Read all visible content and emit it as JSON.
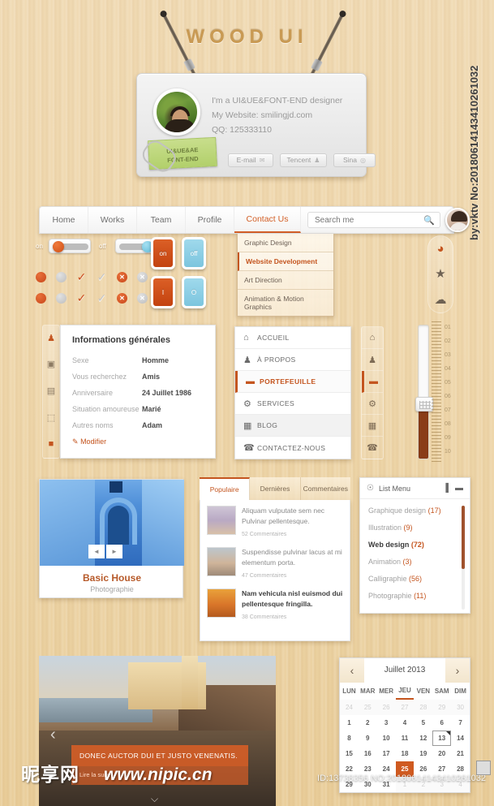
{
  "sign": {
    "title": "WOOD UI"
  },
  "profile": {
    "line1": "I'm a UI&UE&FONT-END designer",
    "line2": "My Website: smilingjd.com",
    "line3": "QQ: 125333110",
    "tag_line1": "UI&UE&AE",
    "tag_line2": "FONT-END",
    "buttons": [
      {
        "label": "E-mail",
        "icon": "envelope-icon",
        "glyph": "✉"
      },
      {
        "label": "Tencent",
        "icon": "penguin-icon",
        "glyph": "♟"
      },
      {
        "label": "Sina",
        "icon": "weibo-icon",
        "glyph": "◎"
      }
    ]
  },
  "nav": {
    "items": [
      {
        "label": "Home",
        "active": false
      },
      {
        "label": "Works",
        "active": false
      },
      {
        "label": "Team",
        "active": false
      },
      {
        "label": "Profile",
        "active": false
      },
      {
        "label": "Contact Us",
        "active": true
      }
    ],
    "search": {
      "placeholder": "Search me",
      "value": "",
      "icon": "search-icon"
    }
  },
  "dropdown": {
    "items": [
      {
        "label": "Graphic Design",
        "active": false
      },
      {
        "label": "Website Development",
        "active": true
      },
      {
        "label": "Art Direction",
        "active": false
      },
      {
        "label": "Animation & Motion Graphics",
        "active": false
      }
    ]
  },
  "toggles": {
    "on_label": "on",
    "off_label": "off",
    "sq_on": "on",
    "sq_off": "off",
    "sq_i": "I",
    "sq_o": "O"
  },
  "social_rail": {
    "items": [
      {
        "name": "chat-bubble-icon",
        "glyph": "◕",
        "color": "#c4551f"
      },
      {
        "name": "star-icon",
        "glyph": "★",
        "color": "#6f6253"
      },
      {
        "name": "cloud-icon",
        "glyph": "☁",
        "color": "#6f6253"
      }
    ]
  },
  "side_rail": {
    "items": [
      {
        "name": "users-icon",
        "glyph": "♟",
        "active": true
      },
      {
        "name": "image-icon",
        "glyph": "▣",
        "active": false
      },
      {
        "name": "save-icon",
        "glyph": "▤",
        "active": false
      },
      {
        "name": "file-icon",
        "glyph": "⬚",
        "active": false
      },
      {
        "name": "inbox-icon",
        "glyph": "■",
        "active": false
      }
    ]
  },
  "info_panel": {
    "title": "Informations générales",
    "rows": [
      {
        "key": "Sexe",
        "value": "Homme"
      },
      {
        "key": "Vous recherchez",
        "value": "Amis"
      },
      {
        "key": "Anniversaire",
        "value": "24 Juillet 1986"
      },
      {
        "key": "Situation amoureuse",
        "value": "Marié"
      },
      {
        "key": "Autres noms",
        "value": "Adam"
      }
    ],
    "edit_label": "Modifier",
    "edit_icon": "pencil-icon"
  },
  "menu_panel": {
    "items": [
      {
        "label": "ACCUEIL",
        "icon": "home-icon",
        "glyph": "⌂",
        "active": false
      },
      {
        "label": "À PROPOS",
        "icon": "user-group-icon",
        "glyph": "♟",
        "active": false
      },
      {
        "label": "PORTEFEUILLE",
        "icon": "briefcase-icon",
        "glyph": "▬",
        "active": true
      },
      {
        "label": "SERVICES",
        "icon": "gear-icon",
        "glyph": "⚙",
        "active": false
      },
      {
        "label": "BLOG",
        "icon": "grid-icon",
        "glyph": "▦",
        "active": false
      },
      {
        "label": "CONTACTEZ-NOUS",
        "icon": "phone-icon",
        "glyph": "☎",
        "active": false
      }
    ]
  },
  "ruler": {
    "ticks": [
      "01",
      "02",
      "03",
      "04",
      "05",
      "06",
      "07",
      "08",
      "09",
      "10"
    ]
  },
  "photo_card": {
    "title": "Basic House",
    "subtitle": "Photographie",
    "prev_icon": "chevron-left-icon",
    "next_icon": "chevron-right-icon",
    "prev_glyph": "◄",
    "next_glyph": "►"
  },
  "tabs_panel": {
    "tabs": [
      {
        "label": "Populaire",
        "active": true
      },
      {
        "label": "Dernières",
        "active": false
      },
      {
        "label": "Commentaires",
        "active": false
      }
    ],
    "posts": [
      {
        "title": "Aliquam vulputate sem nec Pulvinar pellentesque.",
        "meta": "52 Commentaires",
        "bold": false
      },
      {
        "title": "Suspendisse pulvinar lacus at mi elementum porta.",
        "meta": "47 Commentaires",
        "bold": false
      },
      {
        "title": "Nam vehicula nisl euismod dui pellentesque fringilla.",
        "meta": "38 Commentaires",
        "bold": true
      }
    ]
  },
  "list_menu": {
    "title": "List Menu",
    "head_icon": "tag-icon",
    "action_icons": [
      {
        "name": "bookmark-icon",
        "glyph": "▐"
      },
      {
        "name": "comment-icon",
        "glyph": "▬"
      }
    ],
    "rows": [
      {
        "label": "Graphique design",
        "count": "(17)",
        "selected": false
      },
      {
        "label": "Illustration",
        "count": "(9)",
        "selected": false
      },
      {
        "label": "Web design",
        "count": "(72)",
        "selected": true
      },
      {
        "label": "Animation",
        "count": "(3)",
        "selected": false
      },
      {
        "label": "Calligraphie",
        "count": "(56)",
        "selected": false
      },
      {
        "label": "Photographie",
        "count": "(11)",
        "selected": false
      }
    ]
  },
  "calendar": {
    "month": "Juillet 2013",
    "prev_icon": "chevron-left-icon",
    "next_icon": "chevron-right-icon",
    "prev_glyph": "‹",
    "next_glyph": "›",
    "weekdays": [
      "LUN",
      "MAR",
      "MER",
      "JEU",
      "VEN",
      "SAM",
      "DIM"
    ],
    "highlighted_weekday": "JEU",
    "weeks": [
      [
        {
          "d": "24",
          "m": true
        },
        {
          "d": "25",
          "m": true
        },
        {
          "d": "26",
          "m": true
        },
        {
          "d": "27",
          "m": true
        },
        {
          "d": "28",
          "m": true
        },
        {
          "d": "29",
          "m": true
        },
        {
          "d": "30",
          "m": true
        }
      ],
      [
        {
          "d": "1"
        },
        {
          "d": "2"
        },
        {
          "d": "3"
        },
        {
          "d": "4"
        },
        {
          "d": "5"
        },
        {
          "d": "6"
        },
        {
          "d": "7"
        }
      ],
      [
        {
          "d": "8"
        },
        {
          "d": "9"
        },
        {
          "d": "10"
        },
        {
          "d": "11"
        },
        {
          "d": "12"
        },
        {
          "d": "13",
          "today": true
        },
        {
          "d": "14"
        }
      ],
      [
        {
          "d": "15"
        },
        {
          "d": "16"
        },
        {
          "d": "17"
        },
        {
          "d": "18"
        },
        {
          "d": "19"
        },
        {
          "d": "20"
        },
        {
          "d": "21"
        }
      ],
      [
        {
          "d": "22"
        },
        {
          "d": "23"
        },
        {
          "d": "24"
        },
        {
          "d": "25",
          "sel": true
        },
        {
          "d": "26"
        },
        {
          "d": "27"
        },
        {
          "d": "28"
        }
      ],
      [
        {
          "d": "29"
        },
        {
          "d": "30"
        },
        {
          "d": "31"
        },
        {
          "d": "1",
          "m": true
        },
        {
          "d": "2",
          "m": true
        },
        {
          "d": "3",
          "m": true
        },
        {
          "d": "4",
          "m": true
        }
      ]
    ]
  },
  "big_slider": {
    "caption": "DONEC AUCTOR DUI ET JUSTO VENENATIS.",
    "more_label": "Lire la suite",
    "prev_icon": "chevron-left-icon",
    "prev_glyph": "‹",
    "down_glyph": "⌵"
  },
  "watermarks": {
    "right": "by:vktv No:20180614143410261032",
    "bottom_id": "ID:13738356 NO:20180614143410261032",
    "logo": "昵享网",
    "site": "www.nipic.cn"
  }
}
